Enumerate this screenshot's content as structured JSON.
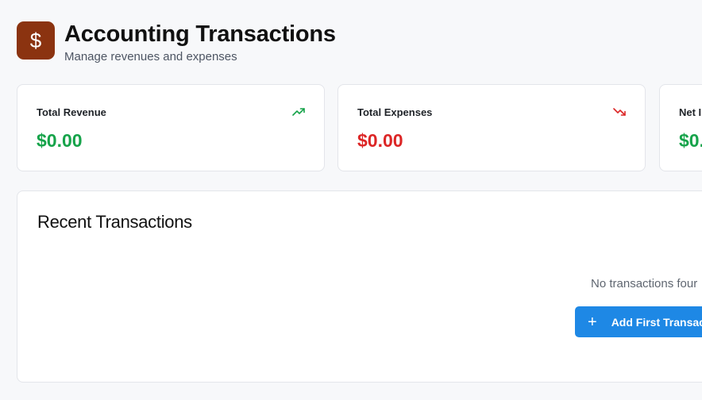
{
  "header": {
    "logo_icon": "dollar-sign-icon",
    "logo_symbol": "$",
    "title": "Accounting Transactions",
    "subtitle": "Manage revenues and expenses"
  },
  "summary": [
    {
      "label": "Total Revenue",
      "value": "$0.00",
      "icon": "trending-up-icon",
      "color": "#16a34a"
    },
    {
      "label": "Total Expenses",
      "value": "$0.00",
      "icon": "trending-down-icon",
      "color": "#dc2626"
    },
    {
      "label": "Net I",
      "value": "$0.",
      "color": "#16a34a"
    }
  ],
  "transactions": {
    "title": "Recent Transactions",
    "empty_message": "No transactions four",
    "add_button_label": "Add First Transact"
  },
  "colors": {
    "brand": "#8b3310",
    "accent": "#1e88e5",
    "background": "#f7f8fa"
  }
}
